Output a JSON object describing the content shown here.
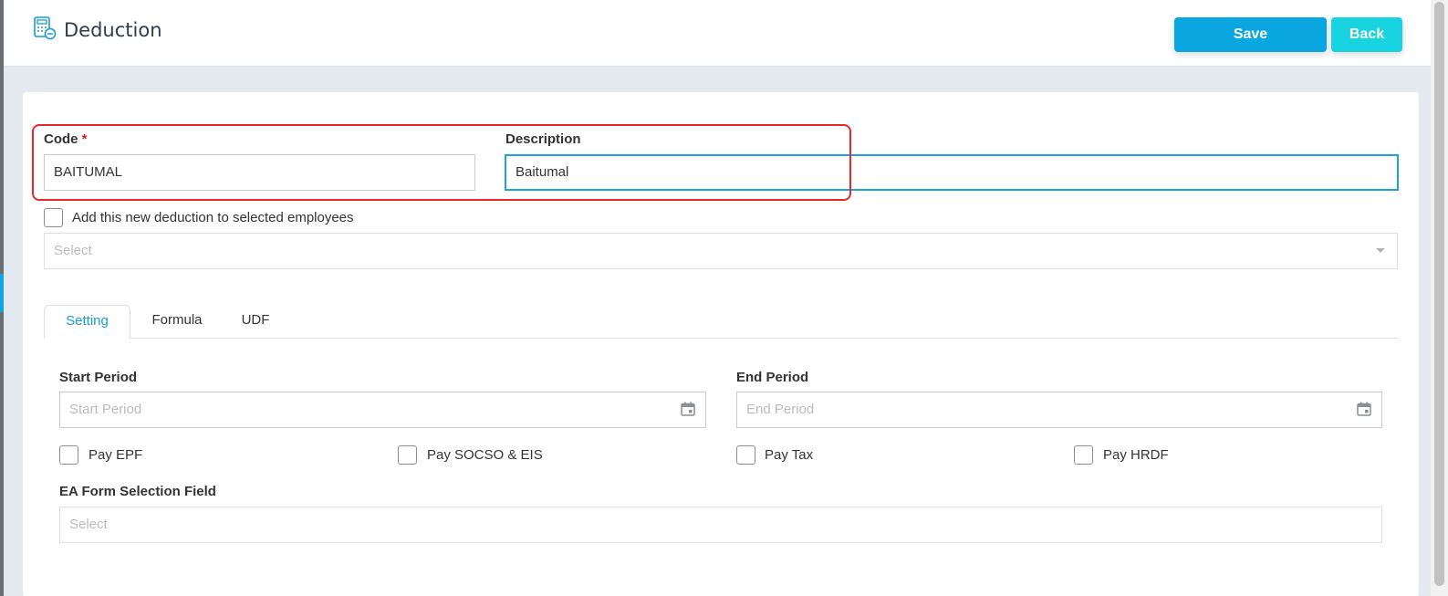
{
  "header": {
    "title": "Deduction",
    "icon": "calculator-minus-icon",
    "save_label": "Save",
    "back_label": "Back"
  },
  "form": {
    "code_label": "Code",
    "code_required_mark": "*",
    "code_value": "BAITUMAL",
    "description_label": "Description",
    "description_value": "Baitumal",
    "add_to_employees_label": "Add this new deduction to selected employees",
    "add_to_employees_checked": false,
    "employees_select_placeholder": "Select"
  },
  "tabs": [
    {
      "label": "Setting",
      "active": true
    },
    {
      "label": "Formula",
      "active": false
    },
    {
      "label": "UDF",
      "active": false
    }
  ],
  "setting": {
    "start_period_label": "Start Period",
    "start_period_placeholder": "Start Period",
    "end_period_label": "End Period",
    "end_period_placeholder": "End Period",
    "checkboxes": [
      {
        "label": "Pay EPF",
        "checked": false
      },
      {
        "label": "Pay SOCSO & EIS",
        "checked": false
      },
      {
        "label": "Pay Tax",
        "checked": false
      },
      {
        "label": "Pay HRDF",
        "checked": false
      }
    ],
    "ea_form_label": "EA Form Selection Field",
    "ea_form_placeholder": "Select"
  },
  "colors": {
    "save_button": "#0aa6e0",
    "back_button": "#18d3e0",
    "active_tab": "#1a9ad6",
    "highlight": "#e8262b",
    "required": "#e0161c"
  }
}
